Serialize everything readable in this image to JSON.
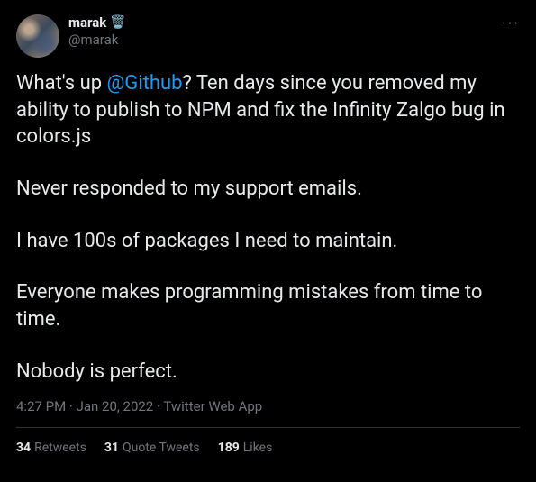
{
  "user": {
    "display_name": "marak",
    "emoji": "🗑️",
    "handle": "@marak"
  },
  "body": {
    "p1_prefix": "What's up ",
    "p1_mention": "@Github",
    "p1_suffix": "? Ten days since you removed my ability to publish to NPM and fix the Infinity Zalgo bug in colors.js",
    "p2": "Never responded to my support emails.",
    "p3": "I have 100s of packages I need to maintain.",
    "p4": "Everyone makes programming mistakes from time to time.",
    "p5": "Nobody is perfect."
  },
  "meta": {
    "time": "4:27 PM",
    "sep1": " · ",
    "date": "Jan 20, 2022",
    "sep2": " · ",
    "source": "Twitter Web App"
  },
  "stats": {
    "retweets_count": "34",
    "retweets_label": "Retweets",
    "quotes_count": "31",
    "quotes_label": "Quote Tweets",
    "likes_count": "189",
    "likes_label": "Likes"
  },
  "more_icon": "···"
}
